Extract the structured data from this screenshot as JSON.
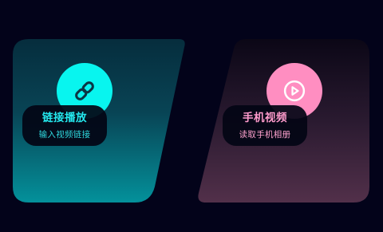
{
  "cards": [
    {
      "title": "链接播放",
      "subtitle": "输入视频链接",
      "icon": "link-icon",
      "icon_color": "#08f5ef",
      "text_color": "#24e8ee"
    },
    {
      "title": "手机视频",
      "subtitle": "读取手机相册",
      "icon": "play-circle-icon",
      "icon_color": "#ff8ec1",
      "text_color": "#ff9bcc"
    }
  ]
}
